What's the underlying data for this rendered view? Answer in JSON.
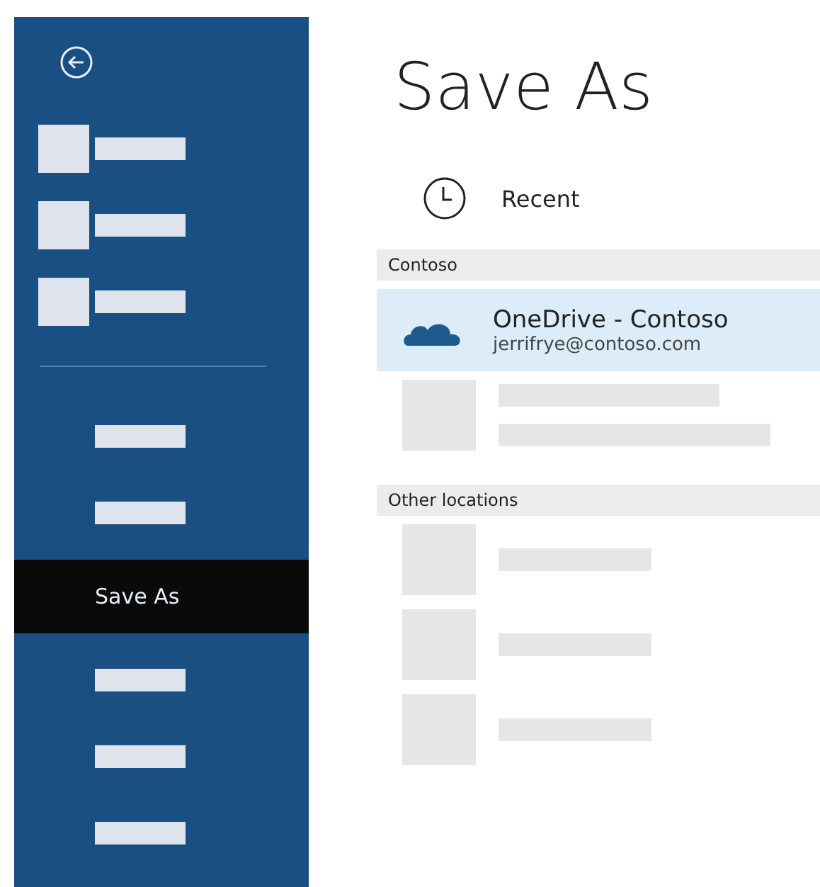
{
  "sidebar": {
    "items": [
      {
        "kind": "placeholder-icon",
        "selected": false
      },
      {
        "kind": "placeholder-icon",
        "selected": false
      },
      {
        "kind": "placeholder-icon",
        "selected": false
      },
      {
        "kind": "divider"
      },
      {
        "kind": "placeholder",
        "selected": false
      },
      {
        "kind": "placeholder",
        "selected": false
      },
      {
        "kind": "label",
        "label": "Save As",
        "selected": true
      },
      {
        "kind": "placeholder",
        "selected": false
      },
      {
        "kind": "placeholder",
        "selected": false
      },
      {
        "kind": "placeholder",
        "selected": false
      }
    ]
  },
  "title": "Save As",
  "recent": {
    "label": "Recent"
  },
  "sections": [
    {
      "header": "Contoso",
      "locations": [
        {
          "kind": "account",
          "name": "OneDrive - Contoso",
          "email": "jerrifrye@contoso.com",
          "selected": true
        },
        {
          "kind": "placeholder-two-line",
          "selected": false
        }
      ]
    },
    {
      "header": "Other locations",
      "locations": [
        {
          "kind": "placeholder-one-line",
          "selected": false
        },
        {
          "kind": "placeholder-one-line",
          "selected": false
        },
        {
          "kind": "placeholder-one-line",
          "selected": false
        }
      ]
    }
  ]
}
